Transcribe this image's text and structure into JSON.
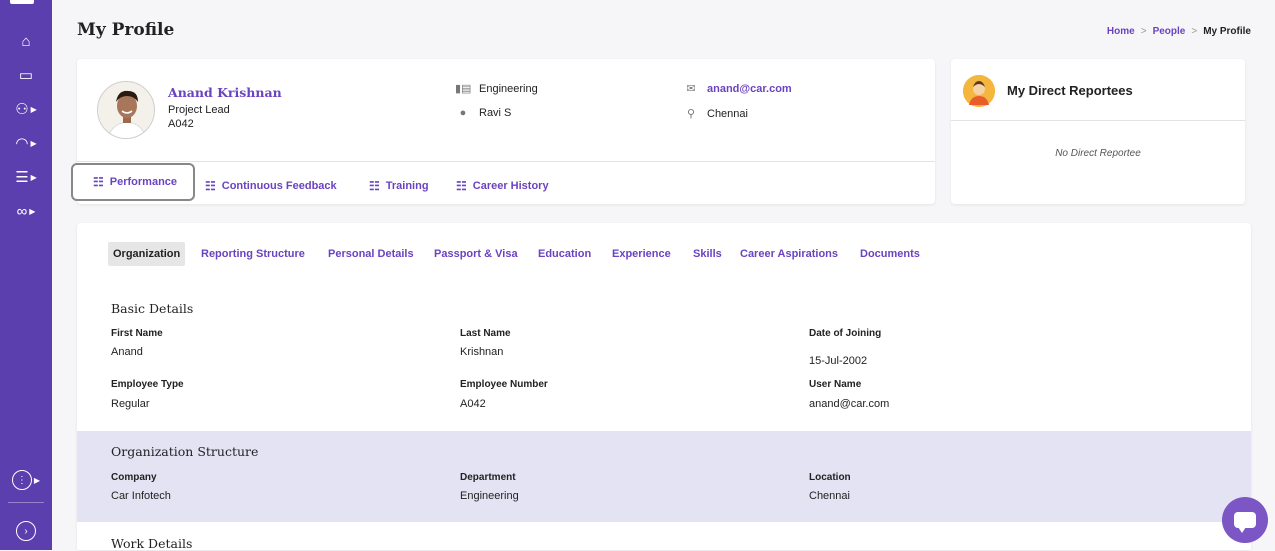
{
  "page": {
    "title": "My Profile"
  },
  "breadcrumb": {
    "home": "Home",
    "people": "People",
    "current": "My Profile",
    "separator": ">"
  },
  "sidebar": {
    "items": [
      {
        "icon": "home-icon",
        "glyph": "⌂",
        "has_submenu": false
      },
      {
        "icon": "monitor-icon",
        "glyph": "▭",
        "has_submenu": false
      },
      {
        "icon": "people-icon",
        "glyph": "⚇",
        "has_submenu": true
      },
      {
        "icon": "dashboard-icon",
        "glyph": "◠",
        "has_submenu": true
      },
      {
        "icon": "database-icon",
        "glyph": "☰",
        "has_submenu": true
      },
      {
        "icon": "handshake-icon",
        "glyph": "∞",
        "has_submenu": true
      }
    ],
    "apps_glyph": "⋮",
    "expand_glyph": "›"
  },
  "profile": {
    "name": "Anand Krishnan",
    "role": "Project Lead",
    "code": "A042",
    "department": "Engineering",
    "manager": "Ravi S",
    "email": "anand@car.com",
    "location": "Chennai",
    "tabs": [
      "Performance",
      "Continuous Feedback",
      "Training",
      "Career History"
    ]
  },
  "reportees": {
    "title": "My Direct Reportees",
    "empty_text": "No Direct Reportee"
  },
  "detail_tabs": [
    "Organization",
    "Reporting Structure",
    "Personal Details",
    "Passport & Visa",
    "Education",
    "Experience",
    "Skills",
    "Career Aspirations",
    "Documents"
  ],
  "basic_details": {
    "title": "Basic Details",
    "fields": [
      {
        "label": "First Name",
        "value": "Anand"
      },
      {
        "label": "Last Name",
        "value": "Krishnan"
      },
      {
        "label": "Date of Joining",
        "value": "15-Jul-2002"
      },
      {
        "label": "Employee Type",
        "value": "Regular"
      },
      {
        "label": "Employee Number",
        "value": "A042"
      },
      {
        "label": "User Name",
        "value": "anand@car.com"
      }
    ]
  },
  "org_structure": {
    "title": "Organization Structure",
    "fields": [
      {
        "label": "Company",
        "value": "Car Infotech"
      },
      {
        "label": "Department",
        "value": "Engineering"
      },
      {
        "label": "Location",
        "value": "Chennai"
      }
    ]
  },
  "work_details": {
    "title": "Work Details"
  },
  "colors": {
    "sidebar": "#5c3fae",
    "accent": "#6a43c0",
    "band": "#e4e3f4",
    "chat": "#7c56c4"
  }
}
